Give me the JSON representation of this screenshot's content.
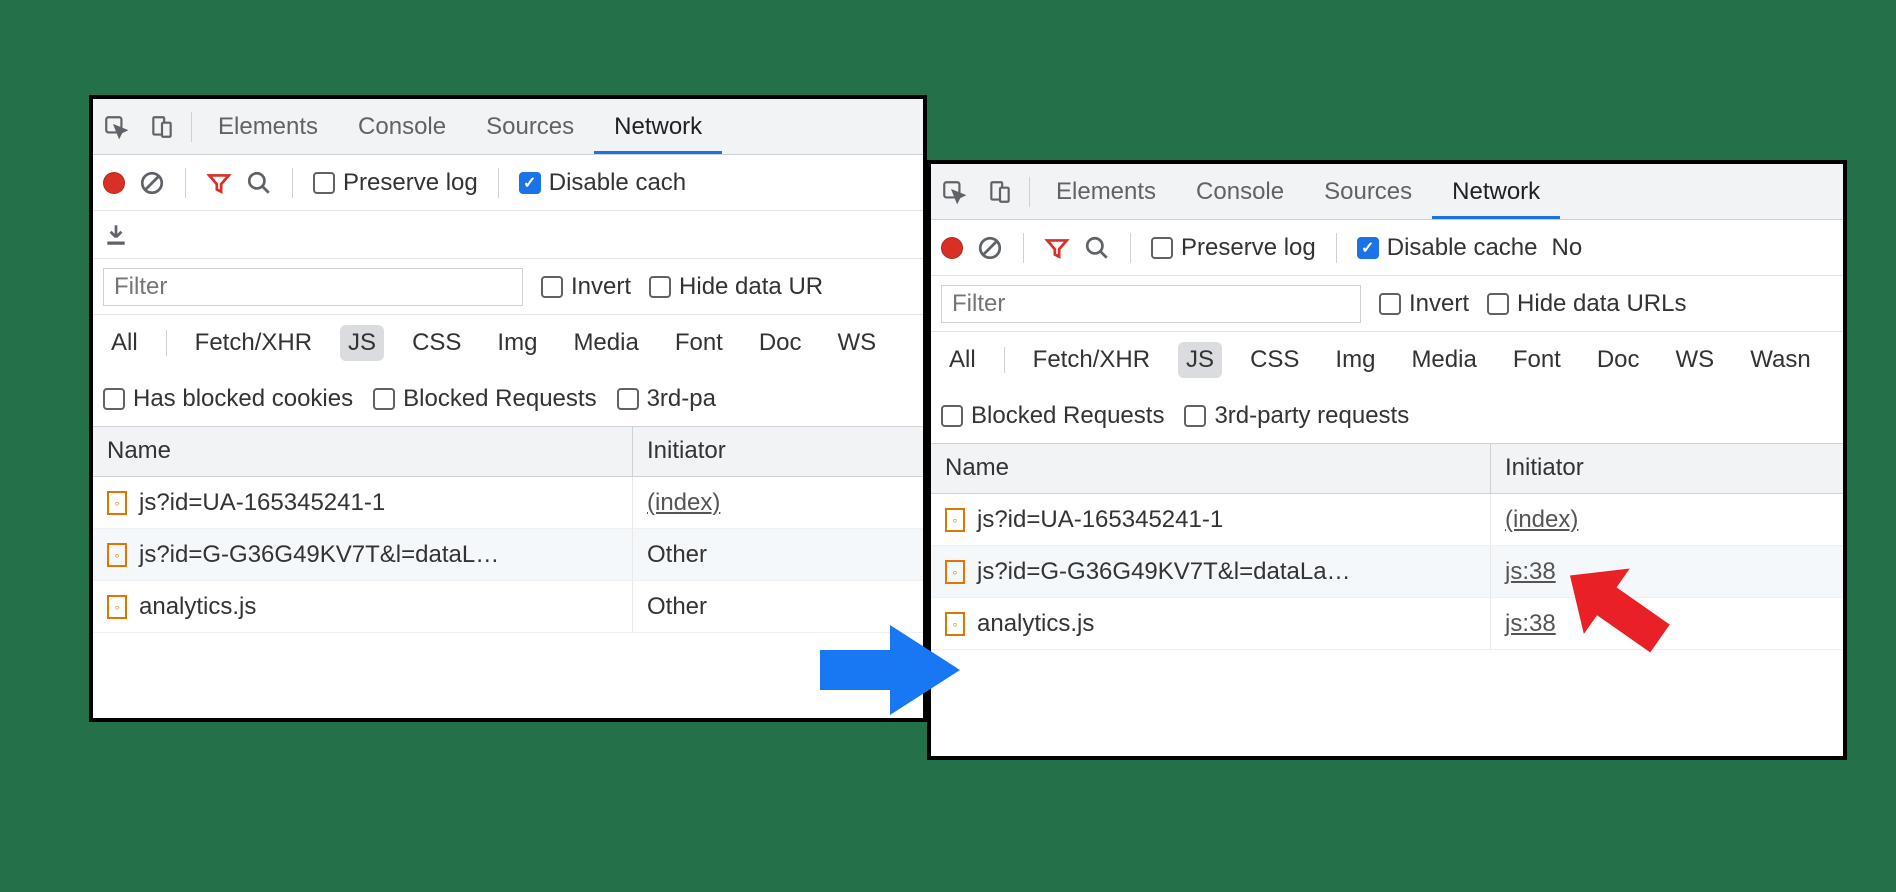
{
  "tabs": {
    "elements": "Elements",
    "console": "Console",
    "sources": "Sources",
    "network": "Network"
  },
  "toolbar": {
    "preserve_log": "Preserve log",
    "disable_cache_left": "Disable cach",
    "disable_cache_right": "Disable cache",
    "no": "No"
  },
  "filter": {
    "placeholder": "Filter",
    "invert": "Invert",
    "hide_left": "Hide data UR",
    "hide_right": "Hide data URLs"
  },
  "types": {
    "all": "All",
    "fetch": "Fetch/XHR",
    "js": "JS",
    "css": "CSS",
    "img": "Img",
    "media": "Media",
    "font": "Font",
    "doc": "Doc",
    "ws": "WS",
    "wasm": "Wasn"
  },
  "extra": {
    "has_blocked": "Has blocked cookies",
    "blocked_req": "Blocked Requests",
    "third_left": "3rd-pa",
    "third_right": "3rd-party requests"
  },
  "columns": {
    "name": "Name",
    "initiator": "Initiator"
  },
  "left_rows": [
    {
      "name": "js?id=UA-165345241-1",
      "initiator": "(index)",
      "u": true
    },
    {
      "name": "js?id=G-G36G49KV7T&l=dataL…",
      "initiator": "Other",
      "u": false
    },
    {
      "name": "analytics.js",
      "initiator": "Other",
      "u": false
    }
  ],
  "right_rows": [
    {
      "name": "js?id=UA-165345241-1",
      "initiator": "(index)",
      "u": true
    },
    {
      "name": "js?id=G-G36G49KV7T&l=dataLa…",
      "initiator": "js:38",
      "u": true
    },
    {
      "name": "analytics.js",
      "initiator": "js:38",
      "u": true
    }
  ]
}
